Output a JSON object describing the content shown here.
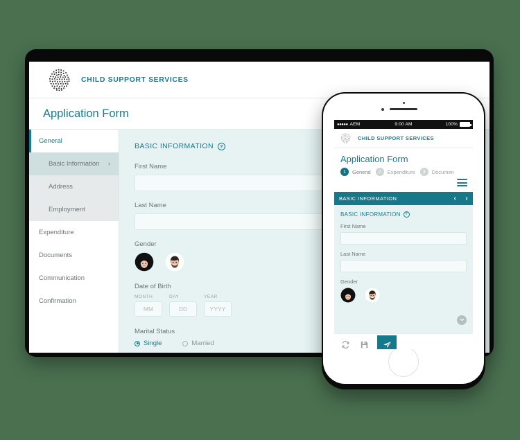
{
  "theme": {
    "background": "#4a7050",
    "accent_teal": "#1a7b8c",
    "bar_teal": "#16798a",
    "form_bg": "#e6f3f2"
  },
  "desktop": {
    "brand": "CHILD SUPPORT SERVICES",
    "logo_icon": "dotted-sphere-logo",
    "page_title": "Application Form",
    "sidebar": {
      "items": [
        {
          "label": "General",
          "type": "top",
          "state": "active"
        },
        {
          "label": "Basic Information",
          "type": "sub",
          "state": "selected",
          "chevron": "›"
        },
        {
          "label": "Address",
          "type": "sub",
          "state": "normal"
        },
        {
          "label": "Employment",
          "type": "sub",
          "state": "normal"
        },
        {
          "label": "Expenditure",
          "type": "top",
          "state": "normal"
        },
        {
          "label": "Documents",
          "type": "top",
          "state": "normal"
        },
        {
          "label": "Communication",
          "type": "top",
          "state": "normal"
        },
        {
          "label": "Confirmation",
          "type": "top",
          "state": "normal"
        }
      ]
    },
    "form": {
      "section_title": "BASIC INFORMATION",
      "help_glyph": "?",
      "first_name_label": "First Name",
      "first_name_value": "",
      "last_name_label": "Last Name",
      "last_name_value": "",
      "gender_label": "Gender",
      "gender_options": [
        "female-avatar",
        "male-avatar"
      ],
      "dob_label": "Date of Birth",
      "dob_fields": [
        {
          "caption": "MONTH",
          "placeholder": "MM",
          "value": ""
        },
        {
          "caption": "DAY",
          "placeholder": "DD",
          "value": ""
        },
        {
          "caption": "YEAR",
          "placeholder": "YYYY",
          "value": ""
        }
      ],
      "marital_label": "Marital Status",
      "marital_options": [
        {
          "label": "Single",
          "selected": true
        },
        {
          "label": "Married",
          "selected": false
        }
      ]
    }
  },
  "phone": {
    "statusbar": {
      "signal": "●●●●●",
      "carrier": "AEM",
      "time": "9:00 AM",
      "battery_pct": "100%",
      "battery_icon": "battery-full-icon"
    },
    "brand": "CHILD SUPPORT SERVICES",
    "logo_icon": "dotted-sphere-logo",
    "page_title": "Application Form",
    "steps": [
      {
        "num": "1",
        "label": "General",
        "current": true
      },
      {
        "num": "2",
        "label": "Expenditure",
        "current": false
      },
      {
        "num": "3",
        "label": "Documen",
        "current": false
      }
    ],
    "menu_icon": "hamburger-menu-icon",
    "section_bar": {
      "title": "BASIC INFORMATION",
      "prev_glyph": "‹",
      "next_glyph": "›"
    },
    "form": {
      "section_title": "BASIC INFORMATION",
      "help_glyph": "?",
      "first_name_label": "First Name",
      "first_name_value": "",
      "last_name_label": "Last Name",
      "last_name_value": "",
      "gender_label": "Gender",
      "collapse_glyph": "⌄"
    },
    "toolbar": {
      "refresh_icon": "refresh-icon",
      "save_icon": "save-floppy-icon",
      "submit_icon": "send-paper-plane-icon"
    },
    "home_button": "home-button"
  }
}
